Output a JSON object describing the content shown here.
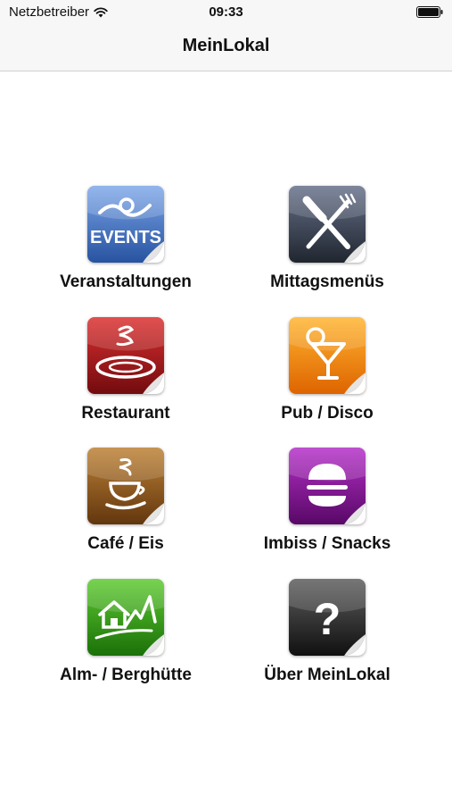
{
  "status_bar": {
    "carrier": "Netzbetreiber",
    "time": "09:33"
  },
  "nav": {
    "title": "MeinLokal"
  },
  "tiles": [
    {
      "label": "Veranstaltungen",
      "icon": "events-icon",
      "icon_text": "EVENTS",
      "color_top": "#6f9be0",
      "color_bottom": "#2c5aa8"
    },
    {
      "label": "Mittagsmenüs",
      "icon": "fork-knife-icon",
      "color_top": "#5b6678",
      "color_bottom": "#232a36"
    },
    {
      "label": "Restaurant",
      "icon": "plate-icon",
      "color_top": "#d42a2a",
      "color_bottom": "#7a0d10"
    },
    {
      "label": "Pub / Disco",
      "icon": "cocktail-icon",
      "color_top": "#ffb02e",
      "color_bottom": "#e06a00"
    },
    {
      "label": "Café / Eis",
      "icon": "coffee-cup-icon",
      "color_top": "#b57a2e",
      "color_bottom": "#6a3b10"
    },
    {
      "label": "Imbiss / Snacks",
      "icon": "burger-icon",
      "color_top": "#b02ac2",
      "color_bottom": "#5e0a6d"
    },
    {
      "label": "Alm- / Berghütte",
      "icon": "mountain-hut-icon",
      "color_top": "#55c32a",
      "color_bottom": "#1d7a0a"
    },
    {
      "label": "Über MeinLokal",
      "icon": "question-icon",
      "icon_text": "?",
      "color_top": "#5a5a5a",
      "color_bottom": "#121212"
    }
  ]
}
